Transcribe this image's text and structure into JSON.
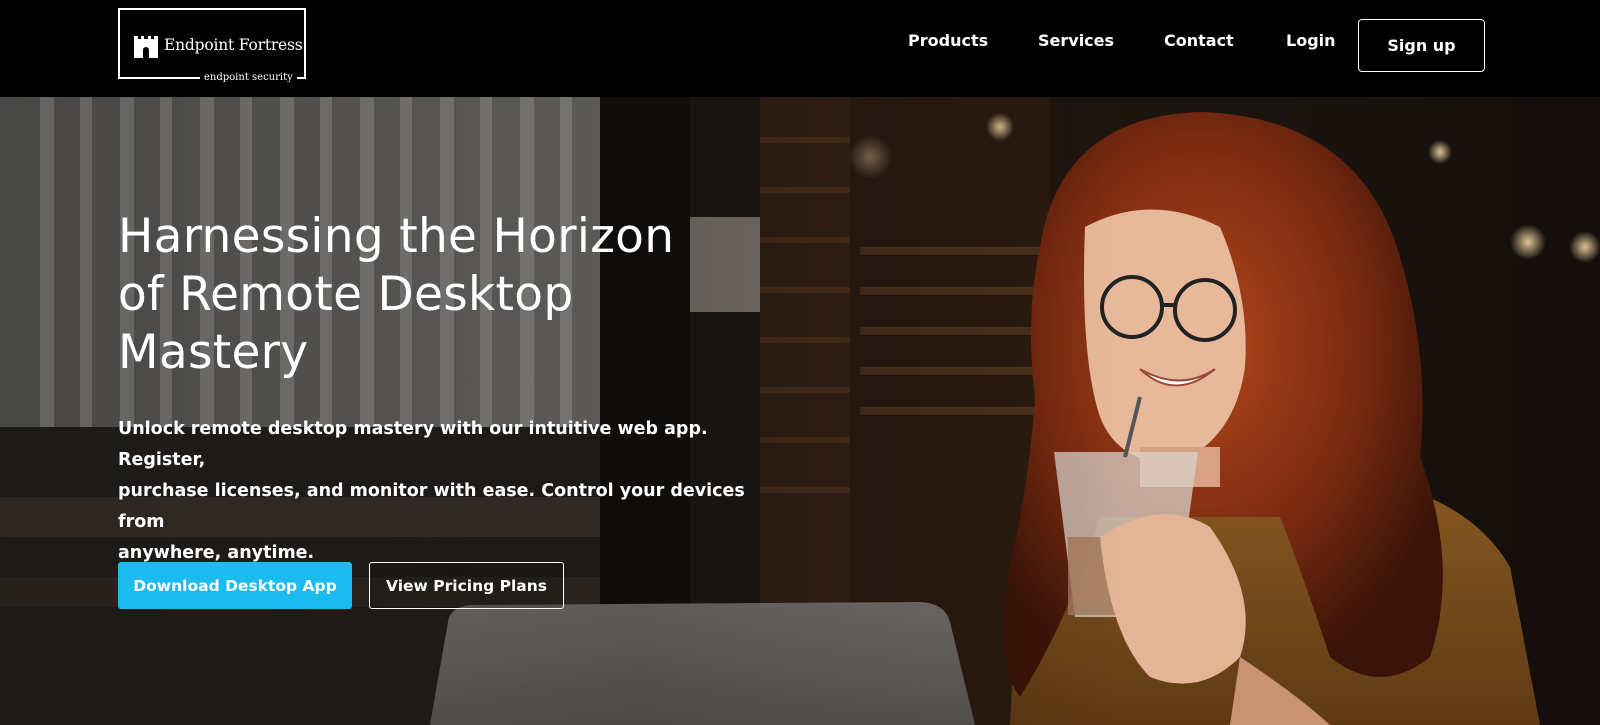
{
  "brand": {
    "name": "Endpoint Fortress",
    "tagline": "endpoint security",
    "logo_icon": "castle-icon"
  },
  "nav": {
    "items": [
      {
        "label": "Products"
      },
      {
        "label": "Services"
      },
      {
        "label": "Contact"
      },
      {
        "label": "Login"
      }
    ],
    "signup_label": "Sign up"
  },
  "hero": {
    "title_lines": [
      "Harnessing the Horizon",
      "of Remote Desktop",
      "Mastery"
    ],
    "description_lines": [
      "Unlock remote desktop mastery with our intuitive web app. Register,",
      "purchase licenses, and monitor with ease. Control your devices from",
      "anywhere, anytime."
    ],
    "primary_cta": "Download Desktop App",
    "secondary_cta": "View Pricing Plans",
    "background_subject": "woman drinking iced coffee at laptop in cafe"
  },
  "colors": {
    "nav_bg": "#000000",
    "accent": "#1bbbf0",
    "text": "#ffffff"
  }
}
